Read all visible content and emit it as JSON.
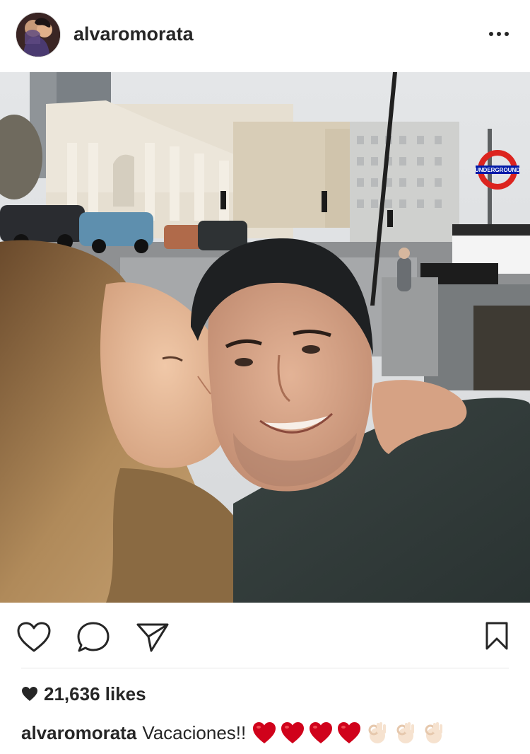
{
  "post": {
    "username": "alvaromorata",
    "likes_text": "21,636 likes",
    "caption_text": "Vacaciones!!",
    "caption_emojis": [
      "red-heart",
      "red-heart",
      "red-heart",
      "red-heart",
      "ok-hand",
      "ok-hand",
      "ok-hand"
    ]
  },
  "photo": {
    "sign_text": "UNDERGROUND"
  },
  "icons": {
    "more": "more-options-icon",
    "like": "heart-outline-icon",
    "comment": "comment-bubble-icon",
    "share": "paper-plane-icon",
    "save": "bookmark-icon",
    "likes_heart": "heart-filled-icon"
  },
  "colors": {
    "text": "#262626",
    "divider": "#e6e6e6",
    "heart_red": "#d0021b",
    "underground_red": "#dc241f",
    "underground_blue": "#0019a8"
  }
}
